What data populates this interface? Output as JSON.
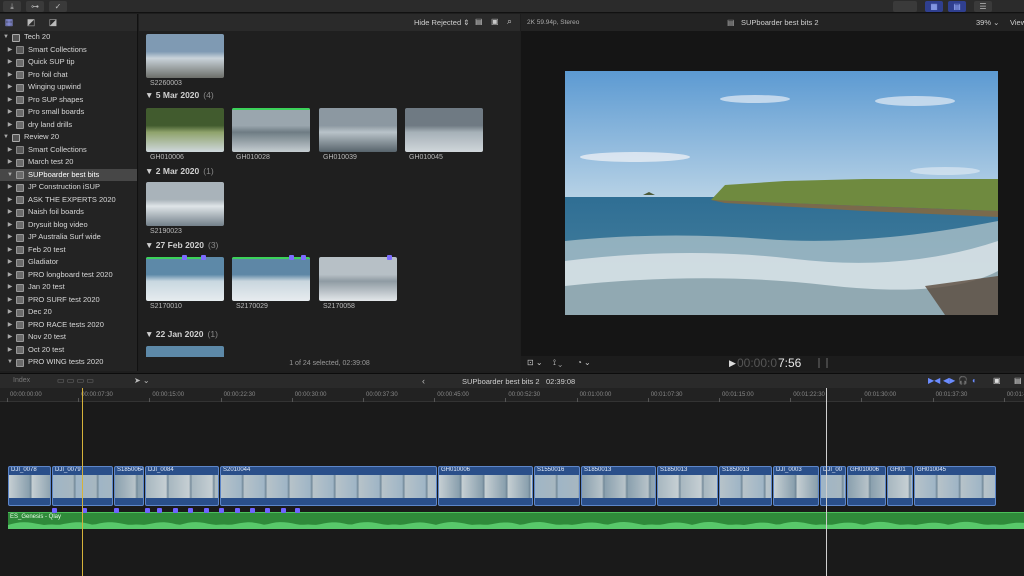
{
  "toolbar": {
    "btn_import": "⤓",
    "btn_keywords": "⊶",
    "btn_check": "✓"
  },
  "sidebar": {
    "items": [
      {
        "label": "Tech 20",
        "kind": "library",
        "indent": 0,
        "tri": "▼"
      },
      {
        "label": "Smart Collections",
        "kind": "smart",
        "indent": 1,
        "tri": "▶"
      },
      {
        "label": "Quick SUP tip",
        "kind": "event",
        "indent": 1,
        "tri": "▶"
      },
      {
        "label": "Pro foil chat",
        "kind": "event",
        "indent": 1,
        "tri": "▶"
      },
      {
        "label": "Winging upwind",
        "kind": "event",
        "indent": 1,
        "tri": "▶"
      },
      {
        "label": "Pro SUP shapes",
        "kind": "event",
        "indent": 1,
        "tri": "▶"
      },
      {
        "label": "Pro small boards",
        "kind": "event",
        "indent": 1,
        "tri": "▶"
      },
      {
        "label": "dry land drills",
        "kind": "event",
        "indent": 1,
        "tri": "▶"
      },
      {
        "label": "Review 20",
        "kind": "library",
        "indent": 0,
        "tri": "▼"
      },
      {
        "label": "Smart Collections",
        "kind": "smart",
        "indent": 1,
        "tri": "▶"
      },
      {
        "label": "March test 20",
        "kind": "event",
        "indent": 1,
        "tri": "▶"
      },
      {
        "label": "SUPboarder best bits",
        "kind": "event",
        "indent": 1,
        "tri": "▼",
        "selected": true
      },
      {
        "label": "JP Construction iSUP",
        "kind": "event",
        "indent": 1,
        "tri": "▶"
      },
      {
        "label": "ASK THE EXPERTS 2020",
        "kind": "event",
        "indent": 1,
        "tri": "▶"
      },
      {
        "label": "Naish foil boards",
        "kind": "event",
        "indent": 1,
        "tri": "▶"
      },
      {
        "label": "Drysuit blog video",
        "kind": "event",
        "indent": 1,
        "tri": "▶"
      },
      {
        "label": "JP Australia Surf wide",
        "kind": "event",
        "indent": 1,
        "tri": "▶"
      },
      {
        "label": "Feb 20 test",
        "kind": "event",
        "indent": 1,
        "tri": "▶"
      },
      {
        "label": "Gladiator",
        "kind": "event",
        "indent": 1,
        "tri": "▶"
      },
      {
        "label": "PRO longboard test 2020",
        "kind": "event",
        "indent": 1,
        "tri": "▶"
      },
      {
        "label": "Jan 20 test",
        "kind": "event",
        "indent": 1,
        "tri": "▶"
      },
      {
        "label": "PRO SURF test 2020",
        "kind": "event",
        "indent": 1,
        "tri": "▶"
      },
      {
        "label": "Dec 20",
        "kind": "event",
        "indent": 1,
        "tri": "▶"
      },
      {
        "label": "PRO RACE tests 2020",
        "kind": "event",
        "indent": 1,
        "tri": "▶"
      },
      {
        "label": "Nov 20 test",
        "kind": "event",
        "indent": 1,
        "tri": "▶"
      },
      {
        "label": "Oct 20 test",
        "kind": "event",
        "indent": 1,
        "tri": "▶"
      },
      {
        "label": "PRO WING tests 2020",
        "kind": "event",
        "indent": 1,
        "tri": "▼"
      }
    ]
  },
  "browser": {
    "filter": "Hide Rejected ⇕",
    "top_clip": "S2260003",
    "groups": [
      {
        "date": "5 Mar 2020",
        "count": "(4)",
        "clips": [
          "GH010006",
          "GH010028",
          "GH010039",
          "GH010045"
        ]
      },
      {
        "date": "2 Mar 2020",
        "count": "(1)",
        "clips": [
          "S2190023"
        ]
      },
      {
        "date": "27 Feb 2020",
        "count": "(3)",
        "clips": [
          "S2170010",
          "S2170029",
          "S2170058"
        ]
      },
      {
        "date": "22 Jan 2020",
        "count": "(1)",
        "clips": []
      }
    ],
    "footer": "1 of 24 selected, 02:39:08"
  },
  "viewer": {
    "format": "2K 59.94p, Stereo",
    "title": "SUPboarder best bits 2",
    "zoom": "39% ⌄",
    "view": "View",
    "timecode_dim": "00:00:0",
    "timecode_bright": "7:56"
  },
  "timeline": {
    "index": "Index",
    "project": "SUPboarder best bits 2",
    "duration": "02:39:08",
    "ruler": [
      "00:00:00:00",
      "00:00:07:30",
      "00:00:15:00",
      "00:00:22:30",
      "00:00:30:00",
      "00:00:37:30",
      "00:00:45:00",
      "00:00:52:30",
      "00:01:00:00",
      "00:01:07:30",
      "00:01:15:00",
      "00:01:22:30",
      "00:01:30:00",
      "00:01:37:30",
      "00:01:45:00"
    ],
    "clips": [
      "DJI_0078",
      "DJI_0079",
      "S1850064",
      "DJI_0084",
      "S2010044",
      "GH010006",
      "S1550016",
      "S1850013",
      "S1850013",
      "S1850013",
      "DJI_0003",
      "DJI_00",
      "GH010006",
      "GH01",
      "GH010045"
    ],
    "audio": "ES_Genesis - Qlay"
  },
  "colors": {
    "accent": "#7b6cff",
    "clip_blue": "#2a4f8a",
    "audio_green": "#2f8a3a",
    "rating_green": "#3cd15a"
  }
}
